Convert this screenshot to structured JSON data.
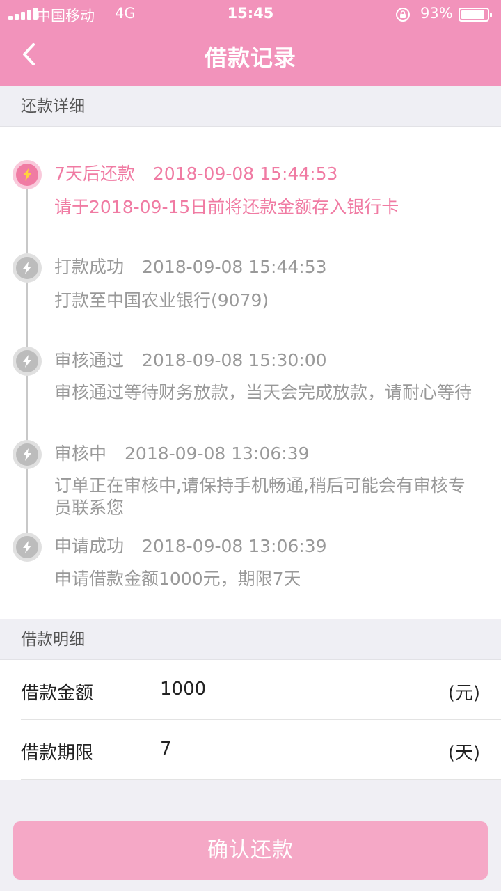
{
  "status_bar": {
    "carrier": "中国移动",
    "network": "4G",
    "time": "15:45",
    "battery_percent": "93%",
    "battery_level": 0.93
  },
  "nav": {
    "title": "借款记录",
    "back_icon": "chevron-left-icon"
  },
  "colors": {
    "accent": "#f293bb",
    "active_text": "#f07ba3",
    "inactive_text": "#999999",
    "button": "#f5a8c6"
  },
  "repayment_section": {
    "header": "还款详细",
    "events": [
      {
        "title": "7天后还款",
        "time": "2018-09-08 15:44:53",
        "desc": "请于2018-09-15日前将还款金额存入银行卡",
        "active": true,
        "icon": "lightning-icon"
      },
      {
        "title": "打款成功",
        "time": "2018-09-08 15:44:53",
        "desc": "打款至中国农业银行(9079)",
        "active": false,
        "icon": "lightning-icon"
      },
      {
        "title": "审核通过",
        "time": "2018-09-08 15:30:00",
        "desc": "审核通过等待财务放款，当天会完成放款，请耐心等待",
        "active": false,
        "icon": "lightning-icon"
      },
      {
        "title": "审核中",
        "time": "2018-09-08 13:06:39",
        "desc": "订单正在审核中,请保持手机畅通,稍后可能会有审核专员联系您",
        "active": false,
        "icon": "lightning-icon"
      },
      {
        "title": "申请成功",
        "time": "2018-09-08 13:06:39",
        "desc": "申请借款金额1000元，期限7天",
        "active": false,
        "icon": "lightning-icon"
      }
    ]
  },
  "loan_section": {
    "header": "借款明细",
    "rows": [
      {
        "label": "借款金额",
        "value": "1000",
        "unit": "(元)"
      },
      {
        "label": "借款期限",
        "value": "7",
        "unit": "(天)"
      }
    ]
  },
  "confirm_button": {
    "label": "确认还款"
  }
}
